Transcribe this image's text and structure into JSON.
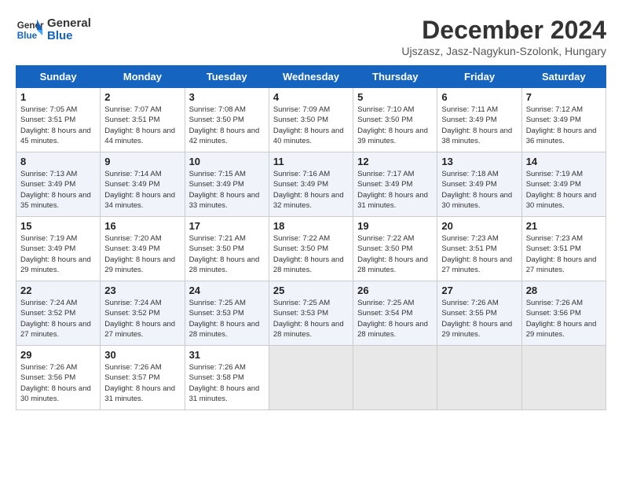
{
  "logo": {
    "line1": "General",
    "line2": "Blue"
  },
  "title": "December 2024",
  "subtitle": "Ujszasz, Jasz-Nagykun-Szolonk, Hungary",
  "days_of_week": [
    "Sunday",
    "Monday",
    "Tuesday",
    "Wednesday",
    "Thursday",
    "Friday",
    "Saturday"
  ],
  "weeks": [
    [
      {
        "day": "1",
        "sunrise": "7:05 AM",
        "sunset": "3:51 PM",
        "daylight": "8 hours and 45 minutes."
      },
      {
        "day": "2",
        "sunrise": "7:07 AM",
        "sunset": "3:51 PM",
        "daylight": "8 hours and 44 minutes."
      },
      {
        "day": "3",
        "sunrise": "7:08 AM",
        "sunset": "3:50 PM",
        "daylight": "8 hours and 42 minutes."
      },
      {
        "day": "4",
        "sunrise": "7:09 AM",
        "sunset": "3:50 PM",
        "daylight": "8 hours and 40 minutes."
      },
      {
        "day": "5",
        "sunrise": "7:10 AM",
        "sunset": "3:50 PM",
        "daylight": "8 hours and 39 minutes."
      },
      {
        "day": "6",
        "sunrise": "7:11 AM",
        "sunset": "3:49 PM",
        "daylight": "8 hours and 38 minutes."
      },
      {
        "day": "7",
        "sunrise": "7:12 AM",
        "sunset": "3:49 PM",
        "daylight": "8 hours and 36 minutes."
      }
    ],
    [
      {
        "day": "8",
        "sunrise": "7:13 AM",
        "sunset": "3:49 PM",
        "daylight": "8 hours and 35 minutes."
      },
      {
        "day": "9",
        "sunrise": "7:14 AM",
        "sunset": "3:49 PM",
        "daylight": "8 hours and 34 minutes."
      },
      {
        "day": "10",
        "sunrise": "7:15 AM",
        "sunset": "3:49 PM",
        "daylight": "8 hours and 33 minutes."
      },
      {
        "day": "11",
        "sunrise": "7:16 AM",
        "sunset": "3:49 PM",
        "daylight": "8 hours and 32 minutes."
      },
      {
        "day": "12",
        "sunrise": "7:17 AM",
        "sunset": "3:49 PM",
        "daylight": "8 hours and 31 minutes."
      },
      {
        "day": "13",
        "sunrise": "7:18 AM",
        "sunset": "3:49 PM",
        "daylight": "8 hours and 30 minutes."
      },
      {
        "day": "14",
        "sunrise": "7:19 AM",
        "sunset": "3:49 PM",
        "daylight": "8 hours and 30 minutes."
      }
    ],
    [
      {
        "day": "15",
        "sunrise": "7:19 AM",
        "sunset": "3:49 PM",
        "daylight": "8 hours and 29 minutes."
      },
      {
        "day": "16",
        "sunrise": "7:20 AM",
        "sunset": "3:49 PM",
        "daylight": "8 hours and 29 minutes."
      },
      {
        "day": "17",
        "sunrise": "7:21 AM",
        "sunset": "3:50 PM",
        "daylight": "8 hours and 28 minutes."
      },
      {
        "day": "18",
        "sunrise": "7:22 AM",
        "sunset": "3:50 PM",
        "daylight": "8 hours and 28 minutes."
      },
      {
        "day": "19",
        "sunrise": "7:22 AM",
        "sunset": "3:50 PM",
        "daylight": "8 hours and 28 minutes."
      },
      {
        "day": "20",
        "sunrise": "7:23 AM",
        "sunset": "3:51 PM",
        "daylight": "8 hours and 27 minutes."
      },
      {
        "day": "21",
        "sunrise": "7:23 AM",
        "sunset": "3:51 PM",
        "daylight": "8 hours and 27 minutes."
      }
    ],
    [
      {
        "day": "22",
        "sunrise": "7:24 AM",
        "sunset": "3:52 PM",
        "daylight": "8 hours and 27 minutes."
      },
      {
        "day": "23",
        "sunrise": "7:24 AM",
        "sunset": "3:52 PM",
        "daylight": "8 hours and 27 minutes."
      },
      {
        "day": "24",
        "sunrise": "7:25 AM",
        "sunset": "3:53 PM",
        "daylight": "8 hours and 28 minutes."
      },
      {
        "day": "25",
        "sunrise": "7:25 AM",
        "sunset": "3:53 PM",
        "daylight": "8 hours and 28 minutes."
      },
      {
        "day": "26",
        "sunrise": "7:25 AM",
        "sunset": "3:54 PM",
        "daylight": "8 hours and 28 minutes."
      },
      {
        "day": "27",
        "sunrise": "7:26 AM",
        "sunset": "3:55 PM",
        "daylight": "8 hours and 29 minutes."
      },
      {
        "day": "28",
        "sunrise": "7:26 AM",
        "sunset": "3:56 PM",
        "daylight": "8 hours and 29 minutes."
      }
    ],
    [
      {
        "day": "29",
        "sunrise": "7:26 AM",
        "sunset": "3:56 PM",
        "daylight": "8 hours and 30 minutes."
      },
      {
        "day": "30",
        "sunrise": "7:26 AM",
        "sunset": "3:57 PM",
        "daylight": "8 hours and 31 minutes."
      },
      {
        "day": "31",
        "sunrise": "7:26 AM",
        "sunset": "3:58 PM",
        "daylight": "8 hours and 31 minutes."
      },
      null,
      null,
      null,
      null
    ]
  ]
}
